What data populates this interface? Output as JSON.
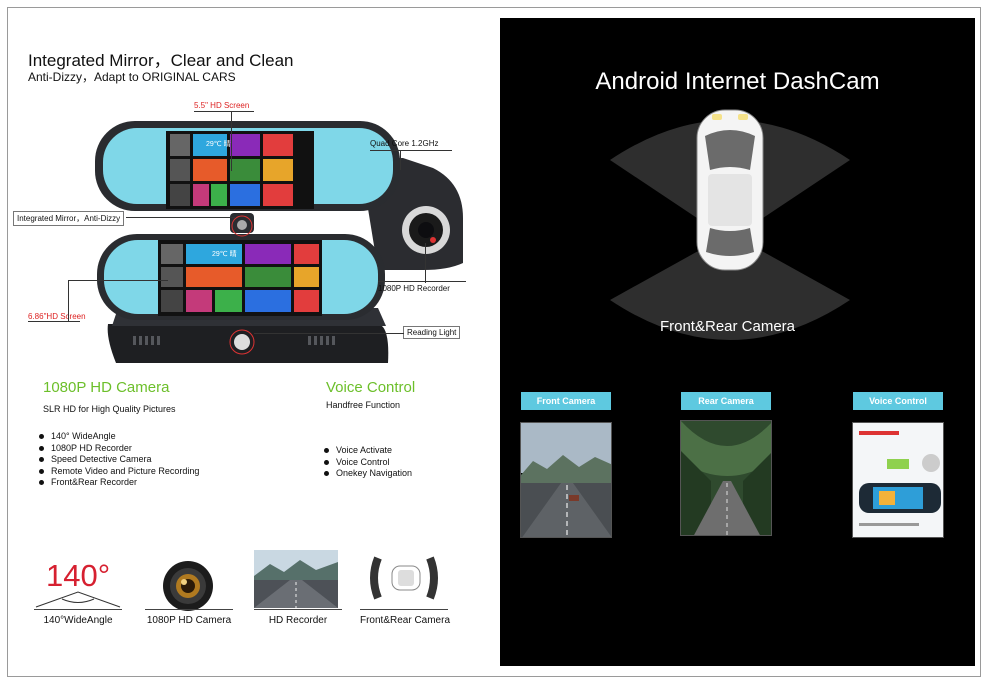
{
  "left": {
    "headline": "Integrated Mirror，Clear and Clean",
    "subheadline": "Anti-Dizzy，Adapt to ORIGINAL CARS",
    "callouts": {
      "hd_screen_55": "5.5\" HD Screen",
      "quad_core": "Quad Core 1.2GHz",
      "integrated_mirror": "Integrated Mirror，Anti-Dizzy",
      "recorder_1080p": "1080P HD Recorder",
      "hd_screen_686": "6.86\"HD Screen",
      "reading_light": "Reading Light"
    },
    "camera_section": {
      "title": "1080P HD Camera",
      "subtitle": "SLR HD for High Quality Pictures",
      "bullets": [
        "140° WideAngle",
        "1080P HD Recorder",
        "Speed Detective Camera",
        "Remote Video and Picture Recording",
        "Front&Rear Recorder"
      ]
    },
    "voice_section": {
      "title": "Voice Control",
      "subtitle": "Handfree Function",
      "bullets": [
        "Voice Activate",
        "Voice Control",
        "Onekey Navigation"
      ]
    },
    "features": {
      "angle_value": "140°",
      "labels": [
        "140°WideAngle",
        "1080P HD Camera",
        "HD Recorder",
        "Front&Rear Camera"
      ]
    },
    "screen_text": {
      "weather": "29℃ 晴"
    }
  },
  "right": {
    "title": "Android Internet DashCam",
    "subtitle": "Front&Rear Camera",
    "tags": [
      "Front Camera",
      "Rear Camera",
      "Voice Control"
    ]
  },
  "colors": {
    "accent_green": "#6cbf2a",
    "callout_red": "#d22222",
    "tag_blue": "#5ec9e0",
    "panel_black": "#000000"
  }
}
